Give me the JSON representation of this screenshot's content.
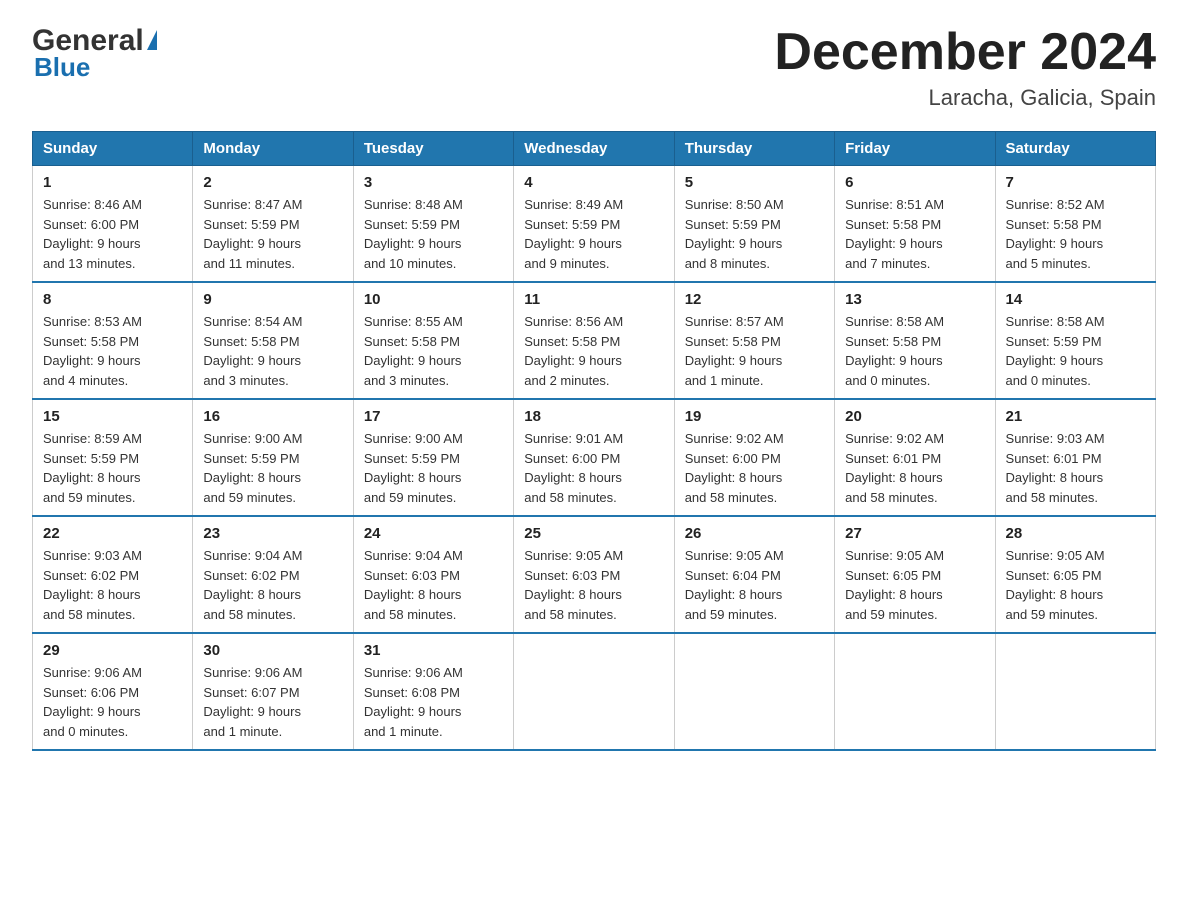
{
  "logo": {
    "text_general": "General",
    "text_blue": "Blue",
    "triangle": "▲"
  },
  "header": {
    "title": "December 2024",
    "subtitle": "Laracha, Galicia, Spain"
  },
  "columns": [
    "Sunday",
    "Monday",
    "Tuesday",
    "Wednesday",
    "Thursday",
    "Friday",
    "Saturday"
  ],
  "weeks": [
    [
      {
        "day": "1",
        "sunrise": "8:46 AM",
        "sunset": "6:00 PM",
        "daylight": "9 hours and 13 minutes."
      },
      {
        "day": "2",
        "sunrise": "8:47 AM",
        "sunset": "5:59 PM",
        "daylight": "9 hours and 11 minutes."
      },
      {
        "day": "3",
        "sunrise": "8:48 AM",
        "sunset": "5:59 PM",
        "daylight": "9 hours and 10 minutes."
      },
      {
        "day": "4",
        "sunrise": "8:49 AM",
        "sunset": "5:59 PM",
        "daylight": "9 hours and 9 minutes."
      },
      {
        "day": "5",
        "sunrise": "8:50 AM",
        "sunset": "5:59 PM",
        "daylight": "9 hours and 8 minutes."
      },
      {
        "day": "6",
        "sunrise": "8:51 AM",
        "sunset": "5:58 PM",
        "daylight": "9 hours and 7 minutes."
      },
      {
        "day": "7",
        "sunrise": "8:52 AM",
        "sunset": "5:58 PM",
        "daylight": "9 hours and 5 minutes."
      }
    ],
    [
      {
        "day": "8",
        "sunrise": "8:53 AM",
        "sunset": "5:58 PM",
        "daylight": "9 hours and 4 minutes."
      },
      {
        "day": "9",
        "sunrise": "8:54 AM",
        "sunset": "5:58 PM",
        "daylight": "9 hours and 3 minutes."
      },
      {
        "day": "10",
        "sunrise": "8:55 AM",
        "sunset": "5:58 PM",
        "daylight": "9 hours and 3 minutes."
      },
      {
        "day": "11",
        "sunrise": "8:56 AM",
        "sunset": "5:58 PM",
        "daylight": "9 hours and 2 minutes."
      },
      {
        "day": "12",
        "sunrise": "8:57 AM",
        "sunset": "5:58 PM",
        "daylight": "9 hours and 1 minute."
      },
      {
        "day": "13",
        "sunrise": "8:58 AM",
        "sunset": "5:58 PM",
        "daylight": "9 hours and 0 minutes."
      },
      {
        "day": "14",
        "sunrise": "8:58 AM",
        "sunset": "5:59 PM",
        "daylight": "9 hours and 0 minutes."
      }
    ],
    [
      {
        "day": "15",
        "sunrise": "8:59 AM",
        "sunset": "5:59 PM",
        "daylight": "8 hours and 59 minutes."
      },
      {
        "day": "16",
        "sunrise": "9:00 AM",
        "sunset": "5:59 PM",
        "daylight": "8 hours and 59 minutes."
      },
      {
        "day": "17",
        "sunrise": "9:00 AM",
        "sunset": "5:59 PM",
        "daylight": "8 hours and 59 minutes."
      },
      {
        "day": "18",
        "sunrise": "9:01 AM",
        "sunset": "6:00 PM",
        "daylight": "8 hours and 58 minutes."
      },
      {
        "day": "19",
        "sunrise": "9:02 AM",
        "sunset": "6:00 PM",
        "daylight": "8 hours and 58 minutes."
      },
      {
        "day": "20",
        "sunrise": "9:02 AM",
        "sunset": "6:01 PM",
        "daylight": "8 hours and 58 minutes."
      },
      {
        "day": "21",
        "sunrise": "9:03 AM",
        "sunset": "6:01 PM",
        "daylight": "8 hours and 58 minutes."
      }
    ],
    [
      {
        "day": "22",
        "sunrise": "9:03 AM",
        "sunset": "6:02 PM",
        "daylight": "8 hours and 58 minutes."
      },
      {
        "day": "23",
        "sunrise": "9:04 AM",
        "sunset": "6:02 PM",
        "daylight": "8 hours and 58 minutes."
      },
      {
        "day": "24",
        "sunrise": "9:04 AM",
        "sunset": "6:03 PM",
        "daylight": "8 hours and 58 minutes."
      },
      {
        "day": "25",
        "sunrise": "9:05 AM",
        "sunset": "6:03 PM",
        "daylight": "8 hours and 58 minutes."
      },
      {
        "day": "26",
        "sunrise": "9:05 AM",
        "sunset": "6:04 PM",
        "daylight": "8 hours and 59 minutes."
      },
      {
        "day": "27",
        "sunrise": "9:05 AM",
        "sunset": "6:05 PM",
        "daylight": "8 hours and 59 minutes."
      },
      {
        "day": "28",
        "sunrise": "9:05 AM",
        "sunset": "6:05 PM",
        "daylight": "8 hours and 59 minutes."
      }
    ],
    [
      {
        "day": "29",
        "sunrise": "9:06 AM",
        "sunset": "6:06 PM",
        "daylight": "9 hours and 0 minutes."
      },
      {
        "day": "30",
        "sunrise": "9:06 AM",
        "sunset": "6:07 PM",
        "daylight": "9 hours and 1 minute."
      },
      {
        "day": "31",
        "sunrise": "9:06 AM",
        "sunset": "6:08 PM",
        "daylight": "9 hours and 1 minute."
      },
      null,
      null,
      null,
      null
    ]
  ],
  "labels": {
    "sunrise": "Sunrise:",
    "sunset": "Sunset:",
    "daylight": "Daylight:"
  }
}
